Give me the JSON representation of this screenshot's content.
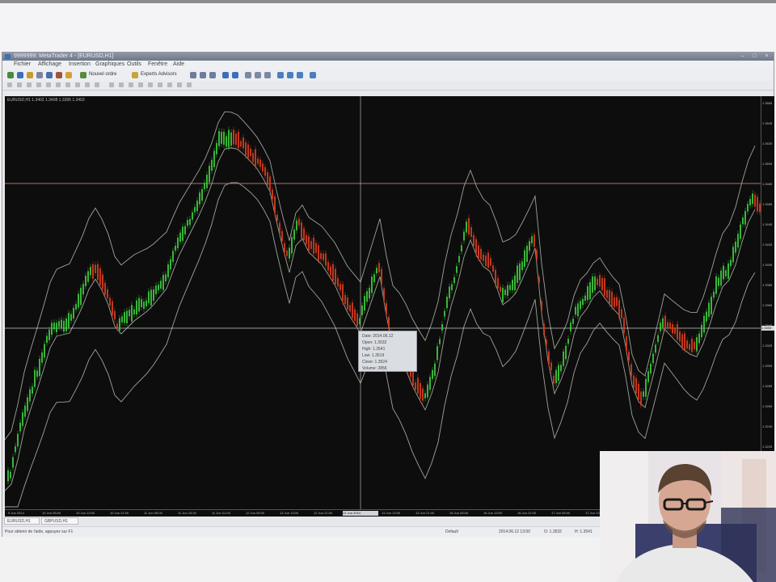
{
  "window": {
    "title": "9999999: MetaTrader 4 - [EURUSD,H1]",
    "controls": [
      "–",
      "□",
      "×"
    ]
  },
  "menu": [
    "Fichier",
    "Affichage",
    "Insertion",
    "Graphiques",
    "Outils",
    "Fenêtre",
    "Aide"
  ],
  "toolbar": {
    "new_order_label": "Nouvel ordre",
    "expert_label": "Experts Advisors"
  },
  "chart": {
    "title": "EURUSD,H1  1.3402 1.3408 1.3395 1.3403",
    "price_labels": [
      "1.3565",
      "1.3545",
      "1.3525",
      "1.3505",
      "1.3485",
      "1.3465",
      "1.3445",
      "1.3425",
      "1.3405",
      "1.3385",
      "1.3365",
      "1.3345",
      "1.3325",
      "1.3305",
      "1.3285",
      "1.3265",
      "1.3245",
      "1.3225",
      "1.3205",
      "1.3185"
    ],
    "price_tag": "1.3403",
    "time_labels": [
      "9 Jun 2014",
      "10 Jun 05:00",
      "10 Jun 13:00",
      "10 Jun 21:00",
      "11 Jun 05:00",
      "11 Jun 13:00",
      "11 Jun 21:00",
      "12 Jun 05:00",
      "12 Jun 13:00",
      "12 Jun 21:00",
      "13 Jun 05:00",
      "13 Jun 13:00",
      "13 Jun 21:00",
      "16 Jun 05:00",
      "16 Jun 13:00",
      "16 Jun 21:00",
      "17 Jun 05:00",
      "17 Jun 13:00",
      "17 Jun 21:00",
      "18 Jun 05:00",
      "18 Jun 13:00",
      "18 Jun 21:00"
    ],
    "highlight_time": "12 Jun 2014",
    "up_color": "#3cc43c",
    "down_color": "#d23c1e",
    "band_color": "#cfd6c8",
    "line_color": "#d48a8a"
  },
  "tooltip": {
    "rows": [
      "Date: 2014.06.12",
      "Open: 1.3532",
      "High: 1.3541",
      "Low: 1.3519",
      "Close: 1.3524",
      "Volume: 2856"
    ]
  },
  "tabs": [
    "EURUSD,H1",
    "GBPUSD,H1"
  ],
  "status": {
    "help": "Pour obtenir de l'aide, appuyez sur F1",
    "profile": "Default",
    "datetime": "2014.06.12 13:00",
    "open": "O: 1.3532",
    "high": "H: 1.3541"
  }
}
